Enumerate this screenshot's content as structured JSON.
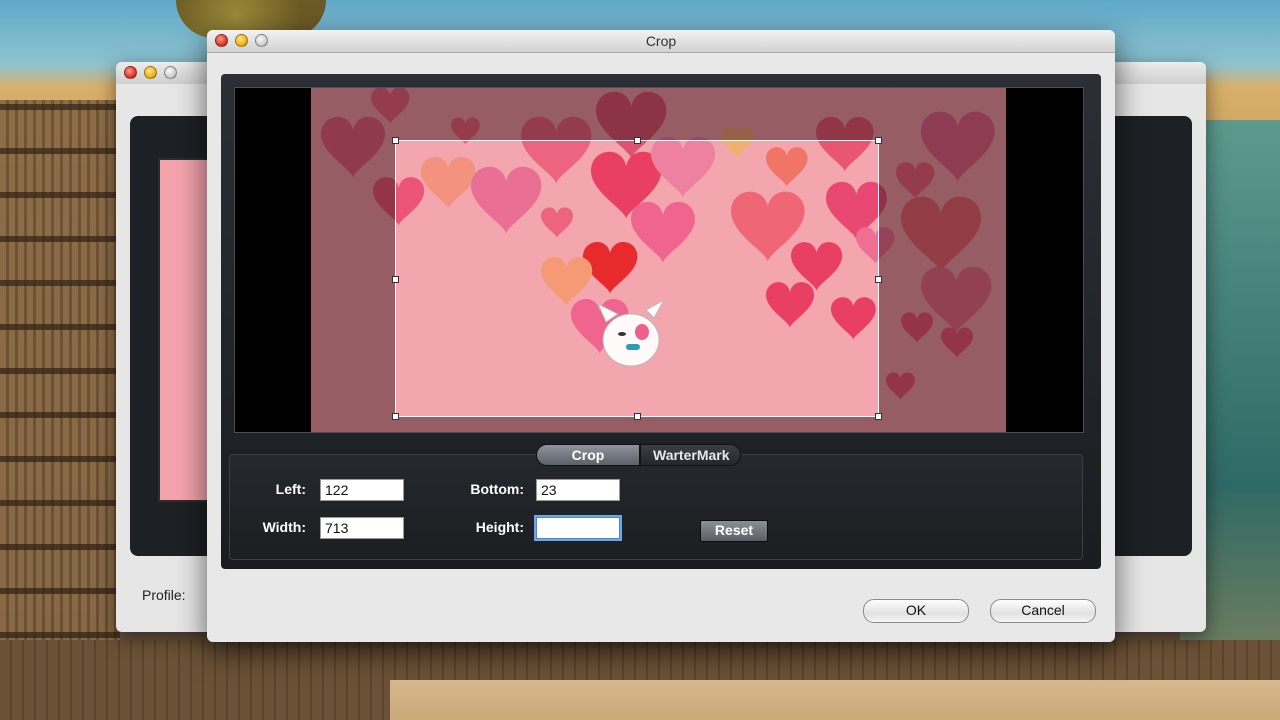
{
  "dialog": {
    "title": "Crop"
  },
  "back_window": {
    "profile_label": "Profile:"
  },
  "tabs": [
    {
      "label": "Crop",
      "active": true
    },
    {
      "label": "WarterMark",
      "active": false
    }
  ],
  "fields": {
    "left": {
      "label": "Left:",
      "value": "122"
    },
    "bottom": {
      "label": "Bottom:",
      "value": "23"
    },
    "width": {
      "label": "Width:",
      "value": "713"
    },
    "height": {
      "label": "Height:",
      "value": ""
    }
  },
  "buttons": {
    "reset": "Reset",
    "ok": "OK",
    "cancel": "Cancel"
  },
  "colors": {
    "video_bg": "#f3a6ae",
    "heart_primary": "#e8345a",
    "heart_red": "#e61e1e",
    "dark_panel": "#1d2024"
  },
  "icons": {
    "traffic_lights": [
      "close-icon",
      "minimize-icon",
      "zoom-icon"
    ]
  }
}
